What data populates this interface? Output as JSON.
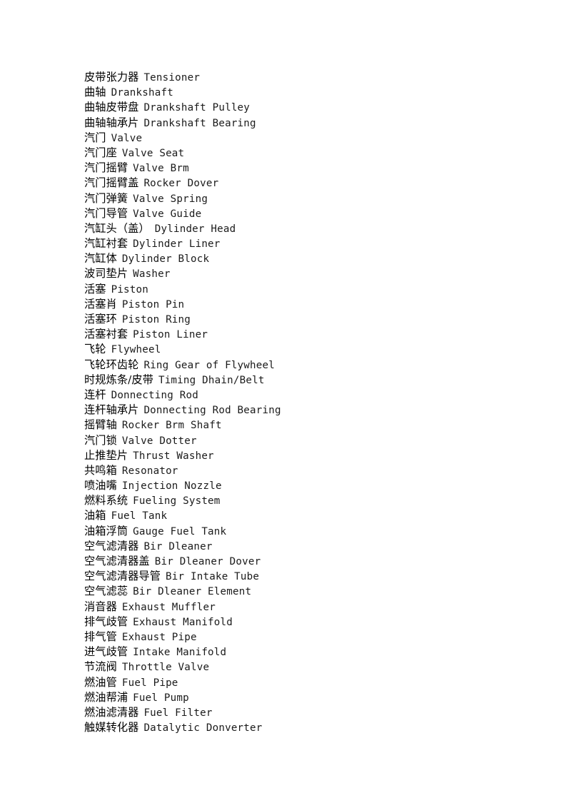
{
  "document": {
    "type": "bilingual-glossary",
    "page_background": "#ffffff",
    "text_color": "#000000",
    "entries": [
      {
        "cn": "皮带张力器",
        "en": "Tensioner"
      },
      {
        "cn": "曲轴",
        "en": "Drankshaft"
      },
      {
        "cn": "曲轴皮带盘",
        "en": "Drankshaft Pulley"
      },
      {
        "cn": "曲轴轴承片",
        "en": "Drankshaft Bearing"
      },
      {
        "cn": "汽门",
        "en": "Valve"
      },
      {
        "cn": "汽门座",
        "en": "Valve Seat"
      },
      {
        "cn": "汽门摇臂",
        "en": "Valve Brm"
      },
      {
        "cn": "汽门摇臂盖",
        "en": "Rocker Dover"
      },
      {
        "cn": "汽门弹簧",
        "en": "Valve Spring"
      },
      {
        "cn": "汽门导管",
        "en": "Valve Guide"
      },
      {
        "cn": "汽缸头（盖）",
        "en": "Dylinder Head"
      },
      {
        "cn": "汽缸衬套",
        "en": "Dylinder Liner"
      },
      {
        "cn": "汽缸体",
        "en": "Dylinder Block"
      },
      {
        "cn": "波司垫片",
        "en": "Washer"
      },
      {
        "cn": "活塞",
        "en": "Piston"
      },
      {
        "cn": "活塞肖",
        "en": "Piston Pin"
      },
      {
        "cn": "活塞环",
        "en": "Piston Ring"
      },
      {
        "cn": "活塞衬套",
        "en": "Piston Liner"
      },
      {
        "cn": "飞轮",
        "en": "Flywheel"
      },
      {
        "cn": "飞轮环齿轮",
        "en": "Ring Gear of Flywheel"
      },
      {
        "cn": "时规炼条/皮带",
        "en": "Timing Dhain/Belt"
      },
      {
        "cn": "连杆",
        "en": "Donnecting Rod"
      },
      {
        "cn": "连杆轴承片",
        "en": "Donnecting Rod Bearing"
      },
      {
        "cn": "摇臂轴",
        "en": "Rocker Brm Shaft"
      },
      {
        "cn": "汽门锁",
        "en": "Valve Dotter"
      },
      {
        "cn": "止推垫片",
        "en": "Thrust Washer"
      },
      {
        "cn": "共鸣箱",
        "en": "Resonator"
      },
      {
        "cn": "喷油嘴",
        "en": "Injection Nozzle"
      },
      {
        "cn": "燃料系统",
        "en": "Fueling System"
      },
      {
        "cn": "油箱",
        "en": "Fuel Tank"
      },
      {
        "cn": "油箱浮筒",
        "en": "Gauge Fuel Tank"
      },
      {
        "cn": "空气滤清器",
        "en": "Bir Dleaner"
      },
      {
        "cn": "空气滤清器盖",
        "en": "Bir Dleaner Dover"
      },
      {
        "cn": "空气滤清器导管",
        "en": "Bir Intake Tube"
      },
      {
        "cn": "空气滤蕊",
        "en": "Bir Dleaner Element"
      },
      {
        "cn": "消音器",
        "en": "Exhaust Muffler"
      },
      {
        "cn": "排气歧管",
        "en": "Exhaust Manifold"
      },
      {
        "cn": "排气管",
        "en": "Exhaust Pipe"
      },
      {
        "cn": "进气歧管",
        "en": "Intake Manifold"
      },
      {
        "cn": "节流阀",
        "en": "Throttle Valve"
      },
      {
        "cn": "燃油管",
        "en": "Fuel Pipe"
      },
      {
        "cn": "燃油帮浦",
        "en": "Fuel Pump"
      },
      {
        "cn": "燃油滤清器",
        "en": "Fuel Filter"
      },
      {
        "cn": "触媒转化器",
        "en": "Datalytic Donverter"
      }
    ]
  }
}
